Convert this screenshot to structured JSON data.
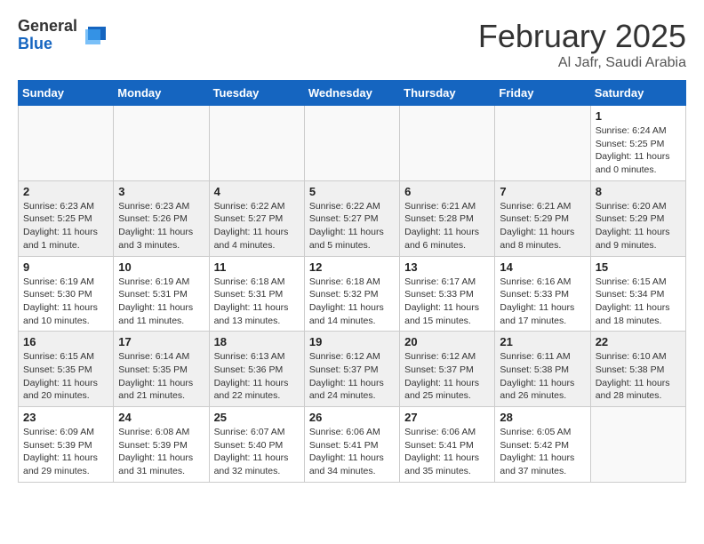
{
  "logo": {
    "general": "General",
    "blue": "Blue"
  },
  "header": {
    "month_year": "February 2025",
    "location": "Al Jafr, Saudi Arabia"
  },
  "weekdays": [
    "Sunday",
    "Monday",
    "Tuesday",
    "Wednesday",
    "Thursday",
    "Friday",
    "Saturday"
  ],
  "weeks": [
    [
      {
        "day": "",
        "info": ""
      },
      {
        "day": "",
        "info": ""
      },
      {
        "day": "",
        "info": ""
      },
      {
        "day": "",
        "info": ""
      },
      {
        "day": "",
        "info": ""
      },
      {
        "day": "",
        "info": ""
      },
      {
        "day": "1",
        "info": "Sunrise: 6:24 AM\nSunset: 5:25 PM\nDaylight: 11 hours\nand 0 minutes."
      }
    ],
    [
      {
        "day": "2",
        "info": "Sunrise: 6:23 AM\nSunset: 5:25 PM\nDaylight: 11 hours\nand 1 minute."
      },
      {
        "day": "3",
        "info": "Sunrise: 6:23 AM\nSunset: 5:26 PM\nDaylight: 11 hours\nand 3 minutes."
      },
      {
        "day": "4",
        "info": "Sunrise: 6:22 AM\nSunset: 5:27 PM\nDaylight: 11 hours\nand 4 minutes."
      },
      {
        "day": "5",
        "info": "Sunrise: 6:22 AM\nSunset: 5:27 PM\nDaylight: 11 hours\nand 5 minutes."
      },
      {
        "day": "6",
        "info": "Sunrise: 6:21 AM\nSunset: 5:28 PM\nDaylight: 11 hours\nand 6 minutes."
      },
      {
        "day": "7",
        "info": "Sunrise: 6:21 AM\nSunset: 5:29 PM\nDaylight: 11 hours\nand 8 minutes."
      },
      {
        "day": "8",
        "info": "Sunrise: 6:20 AM\nSunset: 5:29 PM\nDaylight: 11 hours\nand 9 minutes."
      }
    ],
    [
      {
        "day": "9",
        "info": "Sunrise: 6:19 AM\nSunset: 5:30 PM\nDaylight: 11 hours\nand 10 minutes."
      },
      {
        "day": "10",
        "info": "Sunrise: 6:19 AM\nSunset: 5:31 PM\nDaylight: 11 hours\nand 11 minutes."
      },
      {
        "day": "11",
        "info": "Sunrise: 6:18 AM\nSunset: 5:31 PM\nDaylight: 11 hours\nand 13 minutes."
      },
      {
        "day": "12",
        "info": "Sunrise: 6:18 AM\nSunset: 5:32 PM\nDaylight: 11 hours\nand 14 minutes."
      },
      {
        "day": "13",
        "info": "Sunrise: 6:17 AM\nSunset: 5:33 PM\nDaylight: 11 hours\nand 15 minutes."
      },
      {
        "day": "14",
        "info": "Sunrise: 6:16 AM\nSunset: 5:33 PM\nDaylight: 11 hours\nand 17 minutes."
      },
      {
        "day": "15",
        "info": "Sunrise: 6:15 AM\nSunset: 5:34 PM\nDaylight: 11 hours\nand 18 minutes."
      }
    ],
    [
      {
        "day": "16",
        "info": "Sunrise: 6:15 AM\nSunset: 5:35 PM\nDaylight: 11 hours\nand 20 minutes."
      },
      {
        "day": "17",
        "info": "Sunrise: 6:14 AM\nSunset: 5:35 PM\nDaylight: 11 hours\nand 21 minutes."
      },
      {
        "day": "18",
        "info": "Sunrise: 6:13 AM\nSunset: 5:36 PM\nDaylight: 11 hours\nand 22 minutes."
      },
      {
        "day": "19",
        "info": "Sunrise: 6:12 AM\nSunset: 5:37 PM\nDaylight: 11 hours\nand 24 minutes."
      },
      {
        "day": "20",
        "info": "Sunrise: 6:12 AM\nSunset: 5:37 PM\nDaylight: 11 hours\nand 25 minutes."
      },
      {
        "day": "21",
        "info": "Sunrise: 6:11 AM\nSunset: 5:38 PM\nDaylight: 11 hours\nand 26 minutes."
      },
      {
        "day": "22",
        "info": "Sunrise: 6:10 AM\nSunset: 5:38 PM\nDaylight: 11 hours\nand 28 minutes."
      }
    ],
    [
      {
        "day": "23",
        "info": "Sunrise: 6:09 AM\nSunset: 5:39 PM\nDaylight: 11 hours\nand 29 minutes."
      },
      {
        "day": "24",
        "info": "Sunrise: 6:08 AM\nSunset: 5:39 PM\nDaylight: 11 hours\nand 31 minutes."
      },
      {
        "day": "25",
        "info": "Sunrise: 6:07 AM\nSunset: 5:40 PM\nDaylight: 11 hours\nand 32 minutes."
      },
      {
        "day": "26",
        "info": "Sunrise: 6:06 AM\nSunset: 5:41 PM\nDaylight: 11 hours\nand 34 minutes."
      },
      {
        "day": "27",
        "info": "Sunrise: 6:06 AM\nSunset: 5:41 PM\nDaylight: 11 hours\nand 35 minutes."
      },
      {
        "day": "28",
        "info": "Sunrise: 6:05 AM\nSunset: 5:42 PM\nDaylight: 11 hours\nand 37 minutes."
      },
      {
        "day": "",
        "info": ""
      }
    ]
  ]
}
